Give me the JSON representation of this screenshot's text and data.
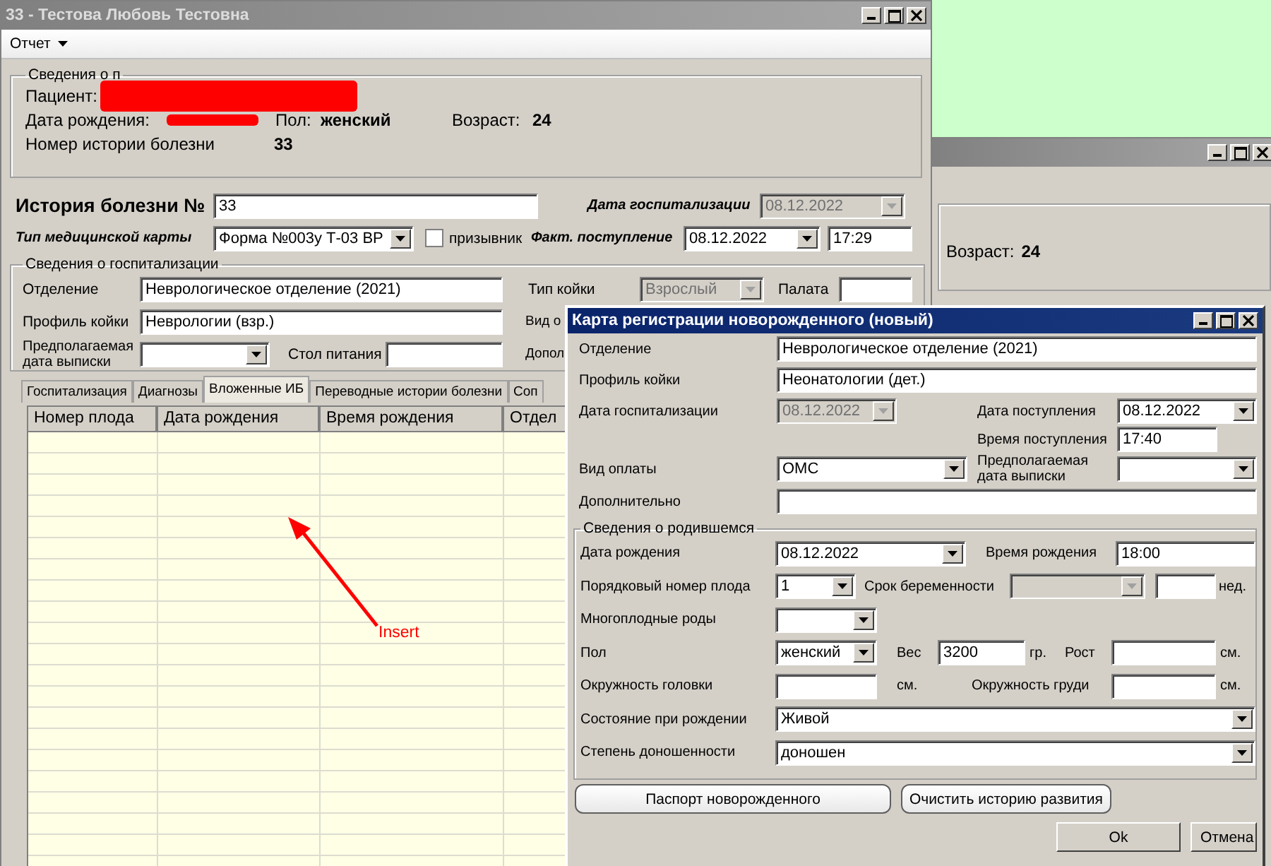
{
  "main_window": {
    "title": "33 - Тестова Любовь Тестовна",
    "menu": [
      {
        "label": "Отчет"
      }
    ],
    "patient": {
      "legend": "Сведения о п",
      "patient_label": "Пациент:",
      "birth_label": "Дата рождения:",
      "sex_label": "Пол:",
      "sex": "женский",
      "age_label": "Возраст:",
      "age": "24",
      "history_label": "Номер истории болезни",
      "history": "33"
    },
    "history": {
      "label": "История болезни №",
      "number": "33",
      "hosp_date_label": "Дата госпитализации",
      "hosp_date": {
        "value": "08.12.2022",
        "disabled": true
      },
      "card_type_label": "Тип медицинской карты",
      "card_type": "Форма №003у Т-03 ВР",
      "conscript": {
        "label": "призывник",
        "checked": false
      },
      "admission_label": "Факт. поступление",
      "admission_date": "08.12.2022",
      "admission_time": "17:29"
    },
    "hospitalization": {
      "legend": "Сведения о госпитализации",
      "department_label": "Отделение",
      "department": "Неврологическое отделение (2021)",
      "bed_type_label": "Тип койки",
      "bed_type": {
        "value": "Взрослый",
        "disabled": true
      },
      "ward_label": "Палата",
      "bed_profile_label": "Профиль койки",
      "bed_profile": "Неврологии (взр.)",
      "label_cut_1": "Вид о",
      "discharge_label": "Предполагаемая дата выписки",
      "diet_label": "Стол питания",
      "label_cut_2": "Допол"
    },
    "tabs": [
      {
        "label": "Госпитализация",
        "selected": false
      },
      {
        "label": "Диагнозы",
        "selected": false
      },
      {
        "label": "Вложенные ИБ",
        "selected": true
      },
      {
        "label": "Переводные истории болезни",
        "selected": false
      },
      {
        "label": "Соп",
        "selected": false
      }
    ],
    "table": {
      "columns": [
        "Номер плода",
        "Дата рождения",
        "Время рождения",
        "Отдел"
      ]
    },
    "annotation": {
      "text": "Insert"
    }
  },
  "back_window": {
    "age_label": "Возраст:",
    "age": "24"
  },
  "dialog": {
    "title": "Карта регистрации новорожденного (новый)",
    "department_label": "Отделение",
    "department": "Неврологическое отделение (2021)",
    "bed_profile_label": "Профиль койки",
    "bed_profile": "Неонатологии (дет.)",
    "hosp_date_label": "Дата госпитализации",
    "hosp_date": {
      "value": "08.12.2022",
      "disabled": true
    },
    "admission_date_label": "Дата поступления",
    "admission_date": "08.12.2022",
    "admission_time_label": "Время поступления",
    "admission_time": "17:40",
    "payment_label": "Вид оплаты",
    "payment": "ОМС",
    "discharge_label": "Предполагаемая дата выписки",
    "extra_label": "Дополнительно",
    "newborn": {
      "legend": "Сведения о родившемся",
      "birth_date_label": "Дата рождения",
      "birth_date": "08.12.2022",
      "birth_time_label": "Время рождения",
      "birth_time": "18:00",
      "fetus_label": "Порядковый номер плода",
      "fetus": "1",
      "gestation_label": "Срок беременности",
      "gestation": {
        "disabled": true
      },
      "weeks_unit": "нед.",
      "multiple_label": "Многоплодные роды",
      "sex_label": "Пол",
      "sex": "женский",
      "weight_label": "Вес",
      "weight": "3200",
      "weight_unit": "гр.",
      "height_label": "Рост",
      "height_unit": "см.",
      "head_label": "Окружность головки",
      "head_unit": "см.",
      "chest_label": "Окружность груди",
      "chest_unit": "см.",
      "state_label": "Состояние при рождении",
      "state": "Живой",
      "term_label": "Степень доношенности",
      "term": "доношен"
    },
    "buttons": [
      {
        "label": "Паспорт новорожденного"
      },
      {
        "label": "Очистить историю развития"
      }
    ],
    "footer_buttons": [
      {
        "label": "Ok"
      },
      {
        "label": "Отмена"
      }
    ]
  }
}
